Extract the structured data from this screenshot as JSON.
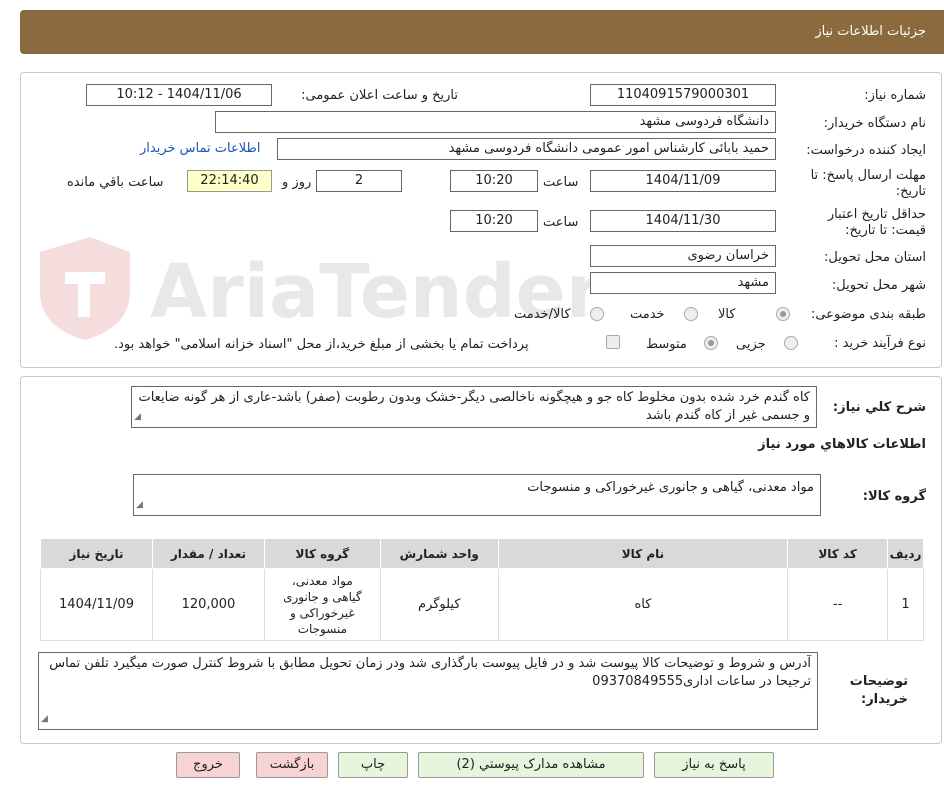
{
  "header": {
    "title": "جزئیات اطلاعات نیاز"
  },
  "watermark": {
    "text": "AriaTender.net"
  },
  "fields": {
    "need_number": {
      "label": "شماره نیاز:",
      "value": "1104091579000301"
    },
    "announce": {
      "label": "تاریخ و ساعت اعلان عمومی:",
      "value": "1404/11/06 - 10:12"
    },
    "buyer_org": {
      "label": "نام دستگاه خریدار:",
      "value": "دانشگاه فردوسی مشهد"
    },
    "requester": {
      "label": "ایجاد کننده درخواست:",
      "value": "حمید بابائی کارشناس امور عمومی دانشگاه فردوسی مشهد"
    },
    "contact_link": "اطلاعات تماس خریدار",
    "deadline": {
      "label_line1": "مهلت ارسال پاسخ: تا",
      "label_line2": "تاریخ:",
      "date": "1404/11/09",
      "time_label": "ساعت",
      "time": "10:20",
      "days": "2",
      "days_label": "روز و",
      "remaining": "22:14:40",
      "remaining_label": "ساعت باقي مانده"
    },
    "price_validity": {
      "label_line1": "حداقل تاریخ اعتبار",
      "label_line2": "قیمت: تا تاریخ:",
      "date": "1404/11/30",
      "time_label": "ساعت",
      "time": "10:20"
    },
    "province": {
      "label": "استان محل تحویل:",
      "value": "خراسان رضوی"
    },
    "city": {
      "label": "شهر محل تحویل:",
      "value": "مشهد"
    },
    "category": {
      "label": "طبقه بندی موضوعی:",
      "options": [
        "کالا",
        "خدمت",
        "کالا/خدمت"
      ],
      "selected": "کالا"
    },
    "process": {
      "label": "نوع فرآیند خرید :",
      "options": [
        "جزیی",
        "متوسط"
      ],
      "selected": "متوسط",
      "payment_note": "پرداخت تمام یا بخشی از مبلغ خرید،از محل \"اسناد خزانه اسلامی\" خواهد بود."
    }
  },
  "summary": {
    "label": "شرح کلي نياز:",
    "text": "کاه گندم خرد شده  بدون مخلوط کاه جو  و هیچگونه ناخالصی دیگر-خشک وبدون  رطوبت (صفر) باشد-عاری از هر گونه ضایعات و جسمی غیر از کاه گندم باشد"
  },
  "goods_section_title": "اطلاعات کالاهاي مورد نياز",
  "goods_group": {
    "label": "گروه کالا:",
    "value": "مواد معدنی، گیاهی و جانوری غیرخوراکی و منسوجات"
  },
  "table": {
    "headers": [
      "ردیف",
      "کد کالا",
      "نام کالا",
      "واحد شمارش",
      "گروه کالا",
      "تعداد / مقدار",
      "تاریخ نیاز"
    ],
    "rows": [
      [
        "1",
        "--",
        "کاه",
        "کیلوگرم",
        "مواد معدنی، گیاهی و جانوری غیرخوراکی و منسوجات",
        "120,000",
        "1404/11/09"
      ]
    ]
  },
  "buyer_notes": {
    "label_line1": "توضیحات",
    "label_line2": "خریدار:",
    "text": "آدرس و شروط  و توضیحات کالا پیوست شد و در فایل پیوست بارگذاری شد ودر زمان تحویل مطابق با شروط کنترل صورت میگیرد تلفن تماس  ترجیحا در ساعات اداری09370849555"
  },
  "buttons": {
    "reply": "پاسخ به نیاز",
    "attachments": "مشاهده مدارک پیوستي (2)",
    "print": "چاپ",
    "back": "بازگشت",
    "exit": "خروج"
  }
}
